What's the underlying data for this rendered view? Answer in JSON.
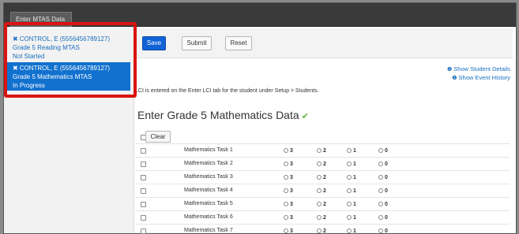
{
  "window": {
    "tab_label": "Enter MTAS Data"
  },
  "sidebar": {
    "students": [
      {
        "name": "CONTROL, E (5556456789127)",
        "test": "Grade 5 Reading MTAS",
        "status": "Not Started",
        "selected": false
      },
      {
        "name": "CONTROL, E (5556456789127)",
        "test": "Grade 5 Mathematics MTAS",
        "status": "In Progress",
        "selected": true
      }
    ]
  },
  "toolbar": {
    "save_label": "Save",
    "submit_label": "Submit",
    "reset_label": "Reset"
  },
  "links": {
    "show_student_details": "Show Student Details",
    "show_event_history": "Show Event History"
  },
  "info_text": "LCI is entered on the Enter LCI tab for the student under Setup > Students.",
  "heading": "Enter Grade 5 Mathematics Data",
  "grid": {
    "clear_label": "Clear",
    "score_options": [
      "3",
      "2",
      "1",
      "0"
    ],
    "tasks": [
      "Mathematics Task 1",
      "Mathematics Task 2",
      "Mathematics Task 3",
      "Mathematics Task 4",
      "Mathematics Task 5",
      "Mathematics Task 6",
      "Mathematics Task 7"
    ]
  },
  "colors": {
    "selected_bg": "#1171ce",
    "save_bg": "#1263d6",
    "link": "#1a6fc0",
    "highlight_border": "#d9140f",
    "check": "#5ab43c"
  },
  "icons": {
    "remove": "close-icon",
    "info": "info-icon",
    "complete": "checkmark-icon"
  }
}
